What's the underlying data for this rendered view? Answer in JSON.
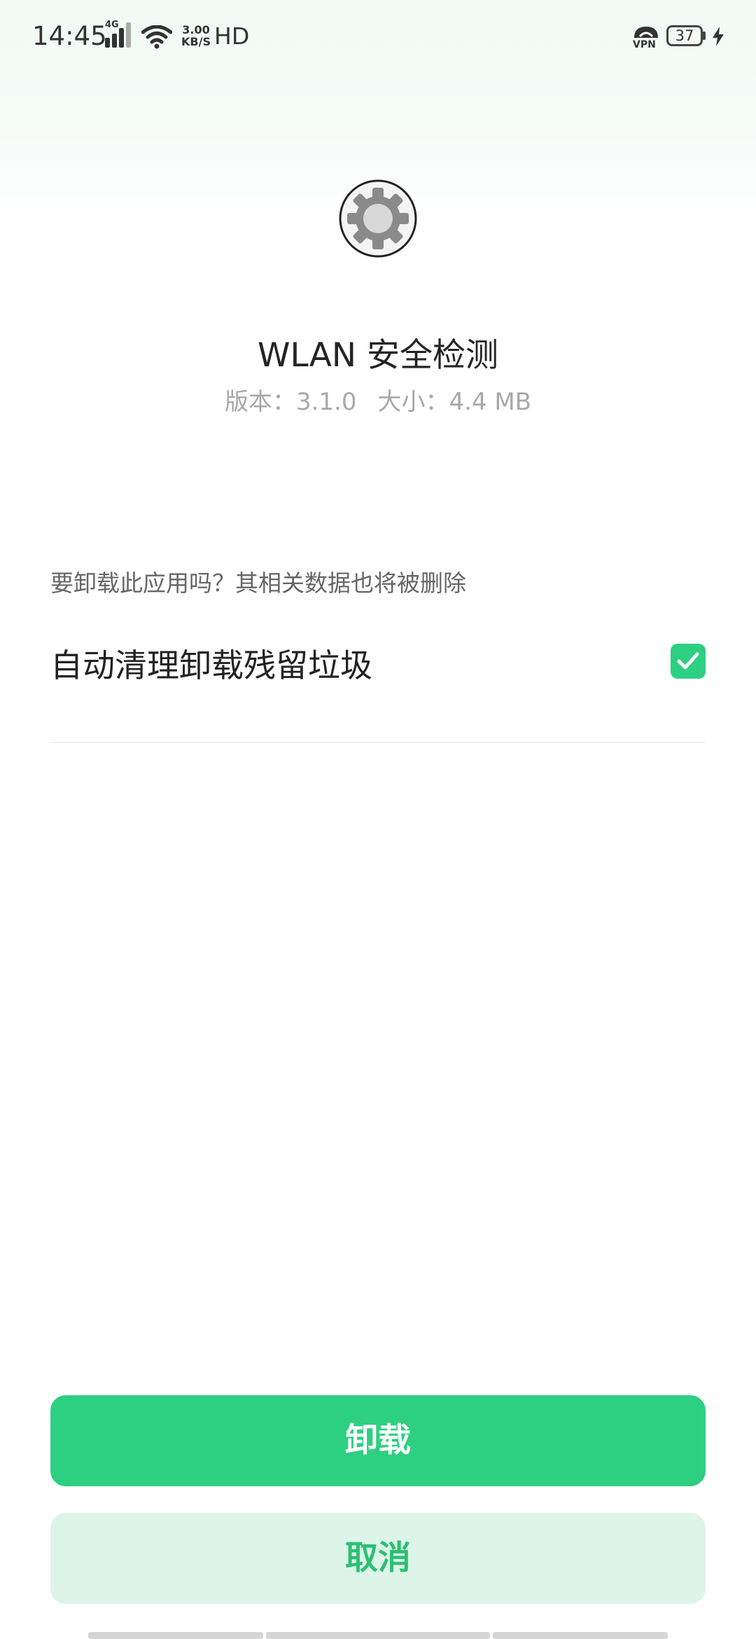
{
  "status_bar": {
    "time": "14:45",
    "network_type": "4G",
    "speed_value": "3.00",
    "speed_unit": "KB/S",
    "hd_label": "HD",
    "vpn_label": "VPN",
    "battery_level": "37"
  },
  "app": {
    "icon": "gear-icon",
    "name": "WLAN 安全检测",
    "version": "版本：3.1.0",
    "size": "大小：4.4 MB"
  },
  "dialog": {
    "question": "要卸载此应用吗？其相关数据也将被删除",
    "cleanup_label": "自动清理卸载残留垃圾",
    "cleanup_checked": true
  },
  "buttons": {
    "uninstall": "卸载",
    "cancel": "取消"
  },
  "colors": {
    "accent": "#2dcf81",
    "cancel_bg": "#dcf5e8",
    "cancel_text": "#2cbf74"
  }
}
